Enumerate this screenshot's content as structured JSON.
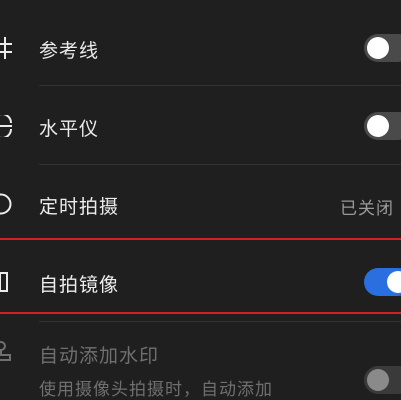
{
  "settings": {
    "gridlines": {
      "label": "参考线",
      "enabled": false
    },
    "level": {
      "label": "水平仪",
      "enabled": false
    },
    "timer": {
      "label": "定时拍摄",
      "value": "已关闭"
    },
    "mirror": {
      "label": "自拍镜像",
      "enabled": true
    },
    "watermark": {
      "label": "自动添加水印",
      "description": "使用摄像头拍摄时，自动添加",
      "enabled": false
    }
  },
  "colors": {
    "background": "#1f1f1f",
    "toggle_on": "#2a6fe0",
    "toggle_off": "#4a4a4a",
    "highlight": "#d21f26"
  },
  "icons": [
    "grid-icon",
    "level-icon",
    "timer-icon",
    "mirror-icon",
    "stamp-icon"
  ]
}
